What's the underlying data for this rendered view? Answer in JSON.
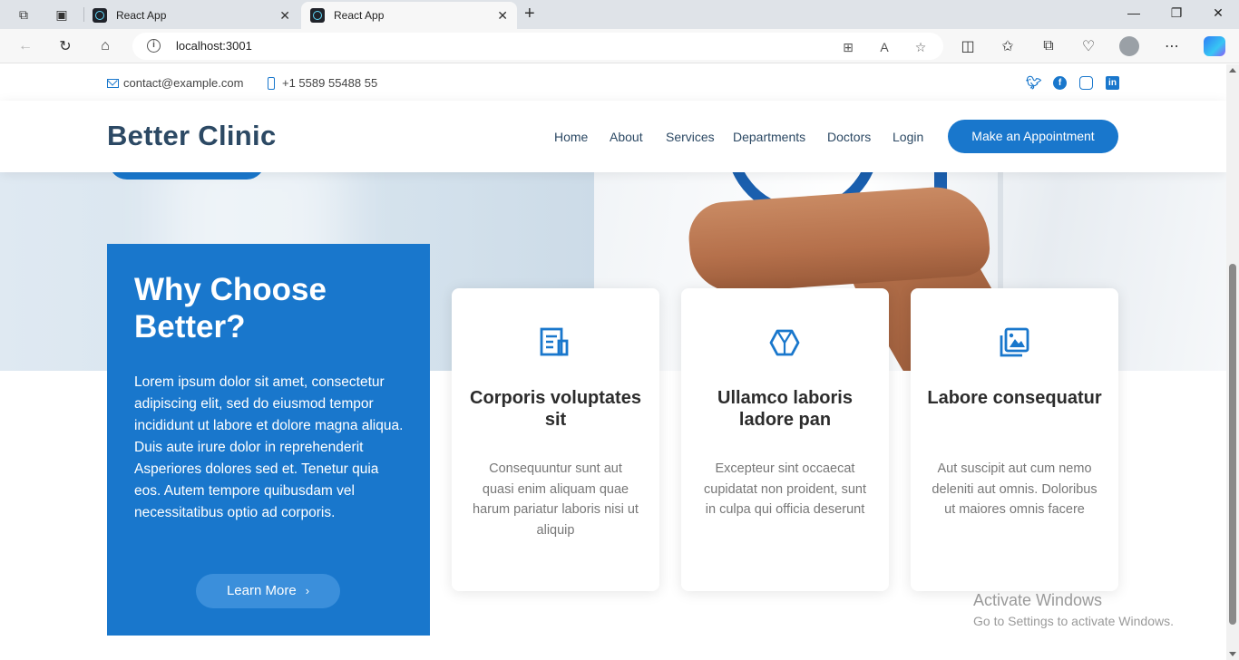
{
  "browser": {
    "tabs": [
      {
        "title": "React App",
        "active": false
      },
      {
        "title": "React App",
        "active": true
      }
    ],
    "url": "localhost:3001"
  },
  "topbar": {
    "email": "contact@example.com",
    "phone": "+1 5589 55488 55",
    "socials": [
      "twitter-icon",
      "facebook-icon",
      "instagram-icon",
      "linkedin-icon"
    ]
  },
  "header": {
    "logo": "Better Clinic",
    "nav": [
      "Home",
      "About",
      "Services",
      "Departments",
      "Doctors",
      "Login"
    ],
    "cta": "Make an Appointment"
  },
  "why": {
    "title": "Why Choose Better?",
    "text": "Lorem ipsum dolor sit amet, consectetur adipiscing elit, sed do eiusmod tempor incididunt ut labore et dolore magna aliqua. Duis aute irure dolor in reprehenderit Asperiores dolores sed et. Tenetur quia eos. Autem tempore quibusdam vel necessitatibus optio ad corporis.",
    "button": "Learn More"
  },
  "cards": [
    {
      "icon": "receipt-icon",
      "title": "Corporis voluptates sit",
      "text": "Consequuntur sunt aut quasi enim aliquam quae harum pariatur laboris nisi ut aliquip"
    },
    {
      "icon": "cube-icon",
      "title": "Ullamco laboris ladore pan",
      "text": "Excepteur sint occaecat cupidatat non proident, sunt in culpa qui officia deserunt"
    },
    {
      "icon": "images-icon",
      "title": "Labore consequatur",
      "text": "Aut suscipit aut cum nemo deleniti aut omnis. Doloribus ut maiores omnis facere"
    }
  ],
  "watermark": {
    "line1": "Activate Windows",
    "line2": "Go to Settings to activate Windows."
  },
  "colors": {
    "accent": "#1977cc",
    "heading": "#2c4964"
  }
}
